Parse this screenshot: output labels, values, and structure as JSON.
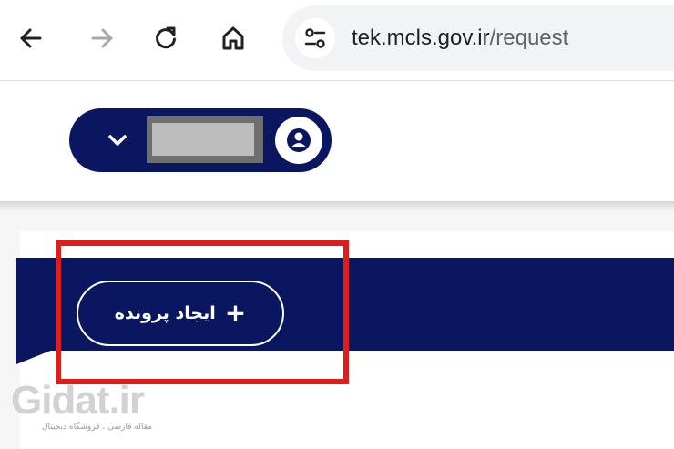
{
  "browser": {
    "url_host": "tek.mcls.gov.ir",
    "url_path": "/request"
  },
  "header": {
    "user_menu": {
      "name_redacted": true
    }
  },
  "main": {
    "create_button_label": "ایجاد پرونده",
    "create_button_icon": "+"
  },
  "watermark": {
    "logo_text": "Gidat.ir",
    "subtitle": "مقاله فارسی ، فروشگاه دیجیتال"
  },
  "colors": {
    "brand_navy": "#0a1660",
    "highlight_red": "#e01d1d",
    "omnibox_bg": "#f1f3f4"
  }
}
